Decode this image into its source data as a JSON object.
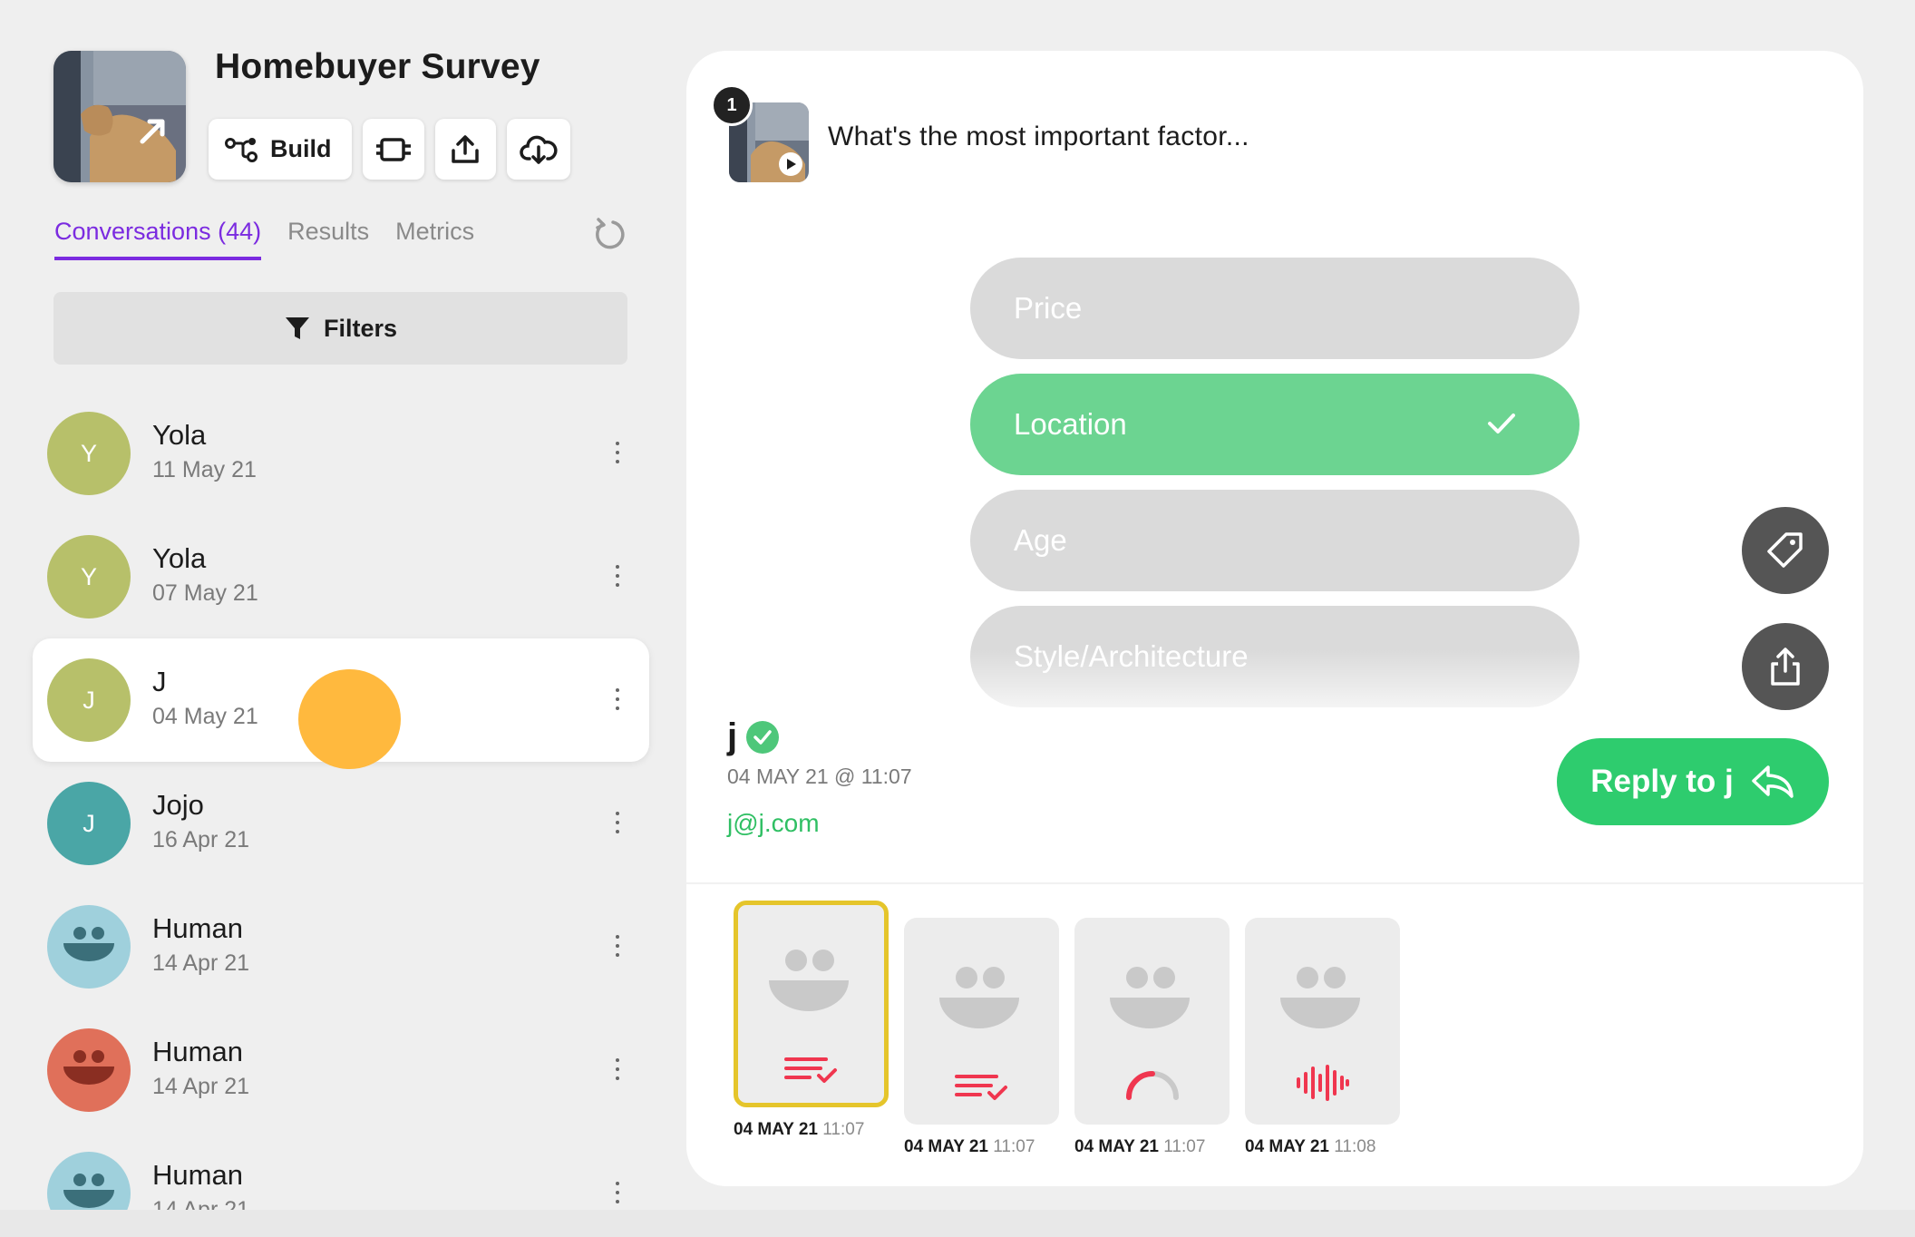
{
  "survey": {
    "title": "Homebuyer Survey",
    "build_label": "Build"
  },
  "tabs": [
    {
      "label": "Conversations (44)",
      "active": true
    },
    {
      "label": "Results",
      "active": false
    },
    {
      "label": "Metrics",
      "active": false
    }
  ],
  "filters_label": "Filters",
  "conversations": [
    {
      "initial": "Y",
      "name": "Yola",
      "date": "11 May 21",
      "avatar_color": "#b7c06a"
    },
    {
      "initial": "Y",
      "name": "Yola",
      "date": "07 May 21",
      "avatar_color": "#b7c06a"
    },
    {
      "initial": "J",
      "name": "J",
      "date": "04 May 21",
      "avatar_color": "#b7c06a",
      "selected": true
    },
    {
      "initial": "J",
      "name": "Jojo",
      "date": "16 Apr 21",
      "avatar_color": "#4aa6a6"
    },
    {
      "initial": "",
      "name": "Human",
      "date": "14 Apr 21",
      "avatar_color": "#9fd0dc"
    },
    {
      "initial": "",
      "name": "Human",
      "date": "14 Apr 21",
      "avatar_color": "#e0705a"
    },
    {
      "initial": "",
      "name": "Human",
      "date": "14 Apr 21",
      "avatar_color": "#9fd0dc"
    }
  ],
  "question": {
    "number": "1",
    "title": "What's the most important factor...",
    "choices": [
      {
        "label": "Price",
        "selected": false
      },
      {
        "label": "Location",
        "selected": true
      },
      {
        "label": "Age",
        "selected": false
      },
      {
        "label": "Style/Architecture",
        "selected": false
      }
    ]
  },
  "respondent": {
    "name": "j",
    "timestamp": "04 MAY 21 @ 11:07",
    "email": "j@j.com",
    "reply_label": "Reply to j"
  },
  "responses": [
    {
      "date": "04 MAY 21",
      "time": "11:07",
      "kind": "multiple-choice",
      "active": true
    },
    {
      "date": "04 MAY 21",
      "time": "11:07",
      "kind": "multiple-choice",
      "active": false
    },
    {
      "date": "04 MAY 21",
      "time": "11:07",
      "kind": "rating",
      "active": false
    },
    {
      "date": "04 MAY 21",
      "time": "11:08",
      "kind": "audio",
      "active": false
    }
  ],
  "colors": {
    "accent": "#7b2be0",
    "selected_choice": "#6cd491",
    "reply_button": "#2ecc6e",
    "response_icon": "#f0364f",
    "active_tile_border": "#e5c52b"
  }
}
